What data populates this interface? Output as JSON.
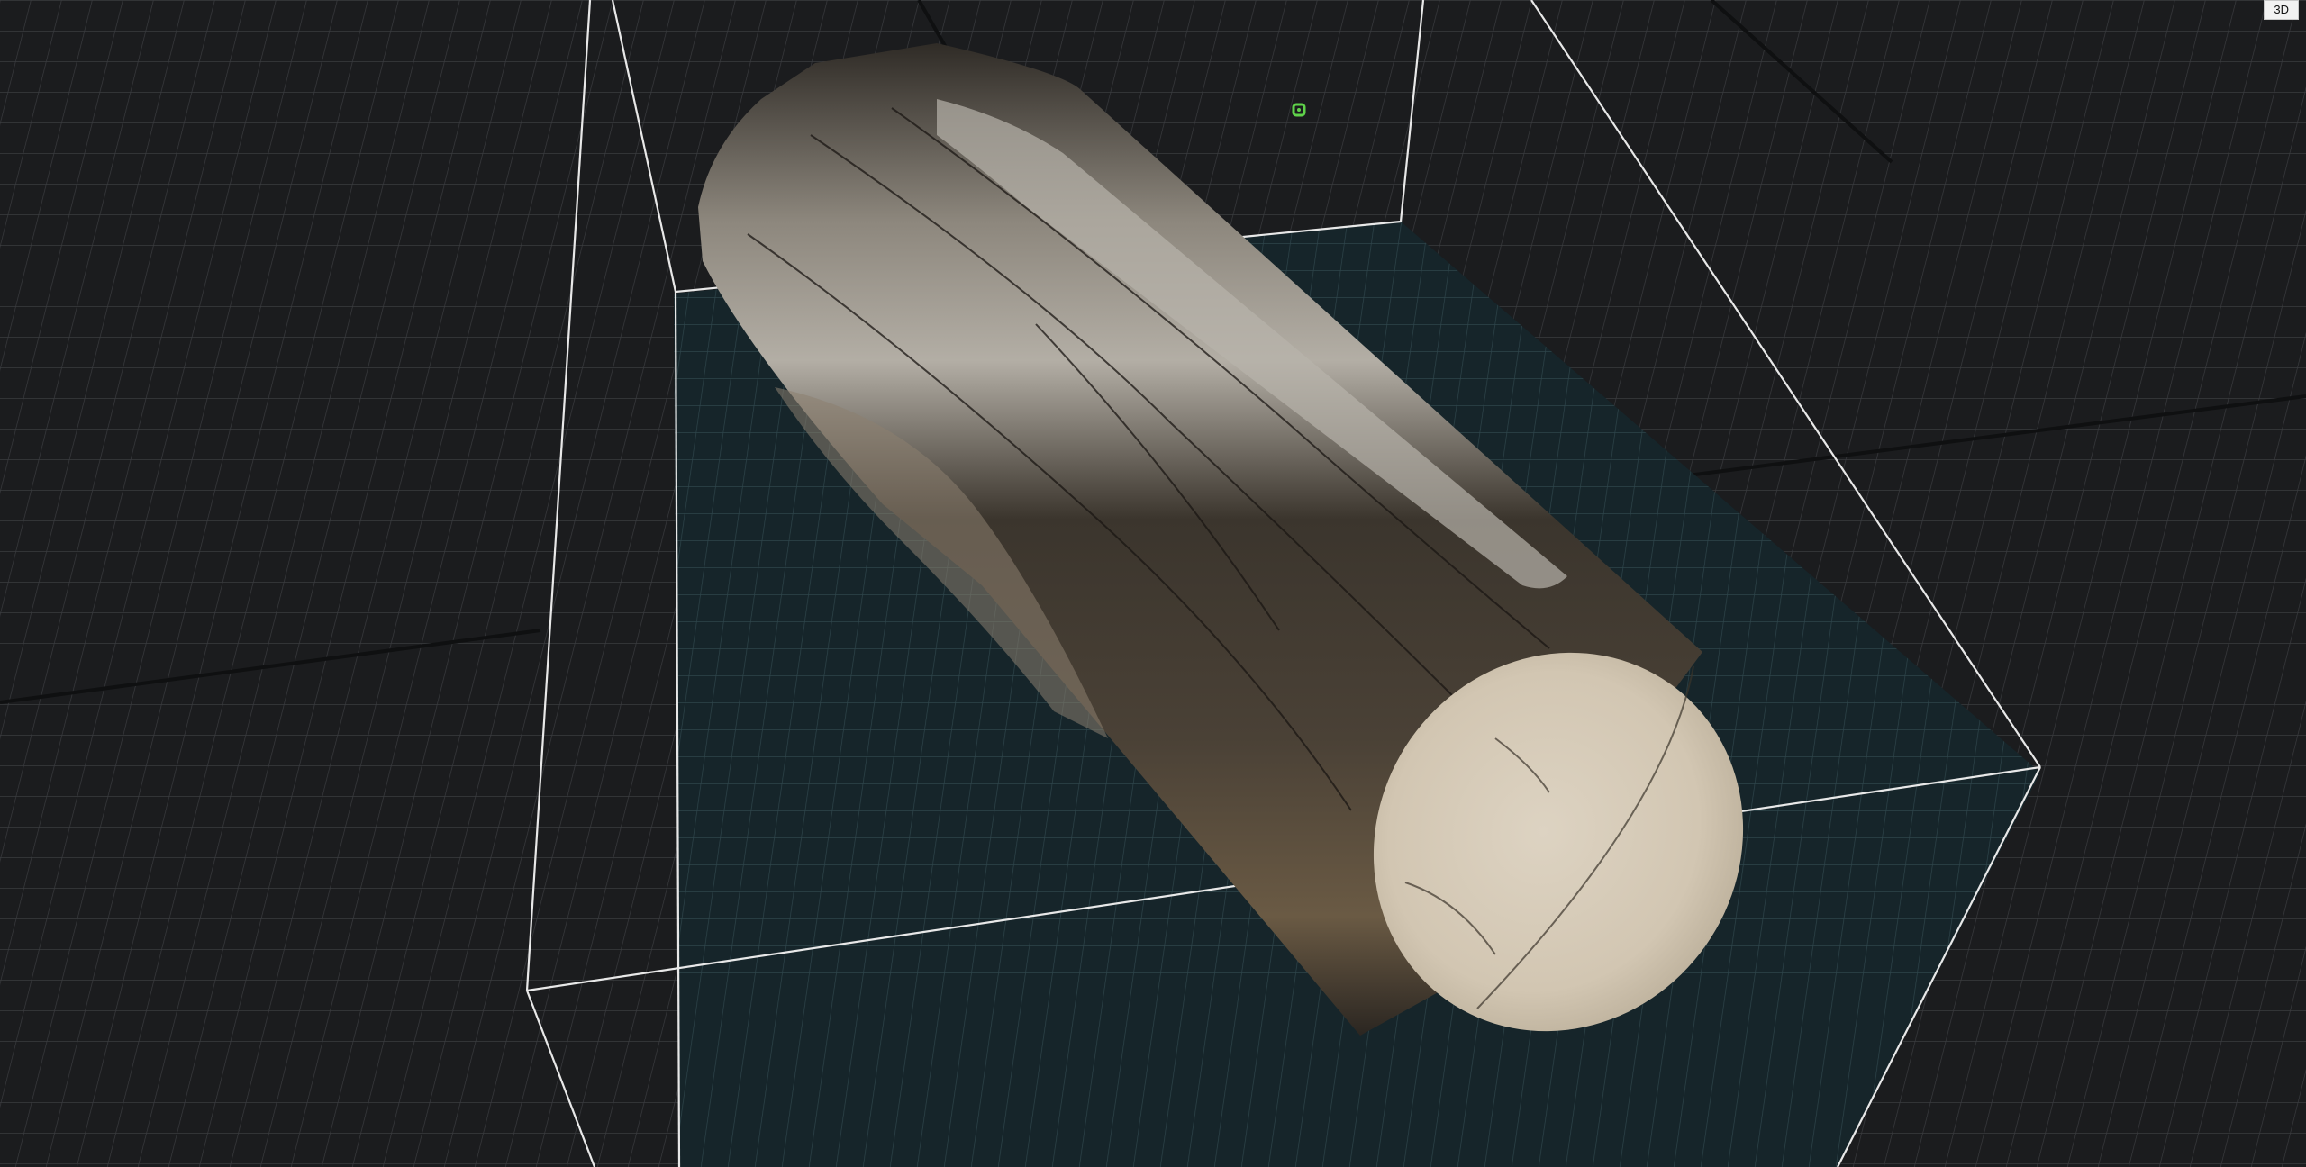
{
  "viewport": {
    "mode_label": "3D"
  },
  "scene": {
    "object": "wooden-log",
    "colors": {
      "background": "#1b1c1e",
      "grid_line": "#3a3c3f",
      "grid_major_line": "#0f1011",
      "floor_fill": "#16252a",
      "floor_grid_line": "#2e454b",
      "bounding_box": "#e8e8e8",
      "marker": "#5fd24a",
      "bark_dark": "#2f2b26",
      "bark_mid": "#5a4e40",
      "bark_light": "#a9a49c",
      "cut_face": "#d8cdbb",
      "cut_face_shadow": "#b9ad98"
    }
  }
}
